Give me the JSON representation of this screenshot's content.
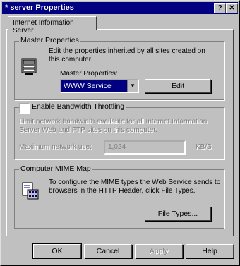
{
  "window": {
    "title": "* server Properties",
    "help_glyph": "?",
    "close_glyph": "✕"
  },
  "tabs": [
    {
      "label": "Internet Information Server"
    }
  ],
  "master_properties": {
    "group_label": "Master Properties",
    "description": "Edit the properties inherited by all sites created on this computer.",
    "dropdown_label": "Master Properties:",
    "selected_value": "WWW Service",
    "edit_button": "Edit"
  },
  "bandwidth": {
    "checkbox_label": "Enable Bandwidth Throttling",
    "checked": false,
    "description": "Limit network bandwidth available for all Internet Information Server Web and FTP sites on this computer.",
    "max_label": "Maximum network use:",
    "max_value": "1,024",
    "unit": "KB/S"
  },
  "mime_map": {
    "group_label": "Computer MIME Map",
    "description": "To configure the MIME types the Web Service sends to browsers in the HTTP Header, click File Types.",
    "file_types_button": "File Types..."
  },
  "footer": {
    "ok": "OK",
    "cancel": "Cancel",
    "apply": "Apply",
    "help": "Help"
  }
}
